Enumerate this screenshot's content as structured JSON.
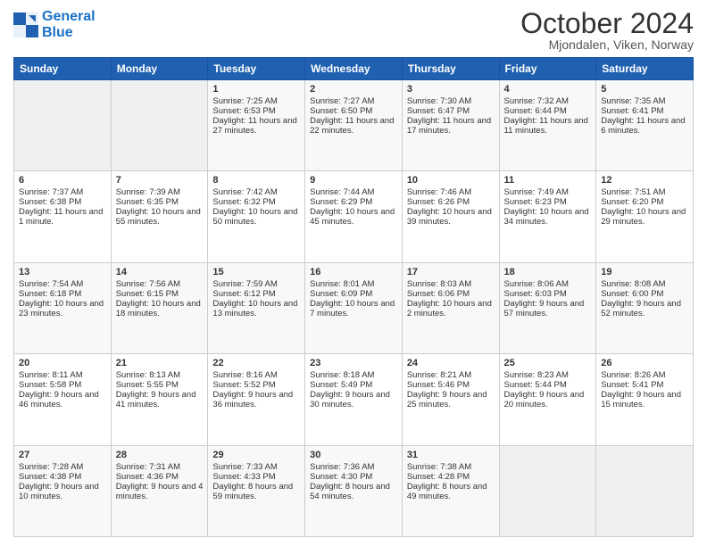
{
  "logo": {
    "line1": "General",
    "line2": "Blue"
  },
  "title": "October 2024",
  "location": "Mjondalen, Viken, Norway",
  "days_of_week": [
    "Sunday",
    "Monday",
    "Tuesday",
    "Wednesday",
    "Thursday",
    "Friday",
    "Saturday"
  ],
  "weeks": [
    [
      {
        "day": "",
        "content": ""
      },
      {
        "day": "",
        "content": ""
      },
      {
        "day": "1",
        "content": "Sunrise: 7:25 AM\nSunset: 6:53 PM\nDaylight: 11 hours and 27 minutes."
      },
      {
        "day": "2",
        "content": "Sunrise: 7:27 AM\nSunset: 6:50 PM\nDaylight: 11 hours and 22 minutes."
      },
      {
        "day": "3",
        "content": "Sunrise: 7:30 AM\nSunset: 6:47 PM\nDaylight: 11 hours and 17 minutes."
      },
      {
        "day": "4",
        "content": "Sunrise: 7:32 AM\nSunset: 6:44 PM\nDaylight: 11 hours and 11 minutes."
      },
      {
        "day": "5",
        "content": "Sunrise: 7:35 AM\nSunset: 6:41 PM\nDaylight: 11 hours and 6 minutes."
      }
    ],
    [
      {
        "day": "6",
        "content": "Sunrise: 7:37 AM\nSunset: 6:38 PM\nDaylight: 11 hours and 1 minute."
      },
      {
        "day": "7",
        "content": "Sunrise: 7:39 AM\nSunset: 6:35 PM\nDaylight: 10 hours and 55 minutes."
      },
      {
        "day": "8",
        "content": "Sunrise: 7:42 AM\nSunset: 6:32 PM\nDaylight: 10 hours and 50 minutes."
      },
      {
        "day": "9",
        "content": "Sunrise: 7:44 AM\nSunset: 6:29 PM\nDaylight: 10 hours and 45 minutes."
      },
      {
        "day": "10",
        "content": "Sunrise: 7:46 AM\nSunset: 6:26 PM\nDaylight: 10 hours and 39 minutes."
      },
      {
        "day": "11",
        "content": "Sunrise: 7:49 AM\nSunset: 6:23 PM\nDaylight: 10 hours and 34 minutes."
      },
      {
        "day": "12",
        "content": "Sunrise: 7:51 AM\nSunset: 6:20 PM\nDaylight: 10 hours and 29 minutes."
      }
    ],
    [
      {
        "day": "13",
        "content": "Sunrise: 7:54 AM\nSunset: 6:18 PM\nDaylight: 10 hours and 23 minutes."
      },
      {
        "day": "14",
        "content": "Sunrise: 7:56 AM\nSunset: 6:15 PM\nDaylight: 10 hours and 18 minutes."
      },
      {
        "day": "15",
        "content": "Sunrise: 7:59 AM\nSunset: 6:12 PM\nDaylight: 10 hours and 13 minutes."
      },
      {
        "day": "16",
        "content": "Sunrise: 8:01 AM\nSunset: 6:09 PM\nDaylight: 10 hours and 7 minutes."
      },
      {
        "day": "17",
        "content": "Sunrise: 8:03 AM\nSunset: 6:06 PM\nDaylight: 10 hours and 2 minutes."
      },
      {
        "day": "18",
        "content": "Sunrise: 8:06 AM\nSunset: 6:03 PM\nDaylight: 9 hours and 57 minutes."
      },
      {
        "day": "19",
        "content": "Sunrise: 8:08 AM\nSunset: 6:00 PM\nDaylight: 9 hours and 52 minutes."
      }
    ],
    [
      {
        "day": "20",
        "content": "Sunrise: 8:11 AM\nSunset: 5:58 PM\nDaylight: 9 hours and 46 minutes."
      },
      {
        "day": "21",
        "content": "Sunrise: 8:13 AM\nSunset: 5:55 PM\nDaylight: 9 hours and 41 minutes."
      },
      {
        "day": "22",
        "content": "Sunrise: 8:16 AM\nSunset: 5:52 PM\nDaylight: 9 hours and 36 minutes."
      },
      {
        "day": "23",
        "content": "Sunrise: 8:18 AM\nSunset: 5:49 PM\nDaylight: 9 hours and 30 minutes."
      },
      {
        "day": "24",
        "content": "Sunrise: 8:21 AM\nSunset: 5:46 PM\nDaylight: 9 hours and 25 minutes."
      },
      {
        "day": "25",
        "content": "Sunrise: 8:23 AM\nSunset: 5:44 PM\nDaylight: 9 hours and 20 minutes."
      },
      {
        "day": "26",
        "content": "Sunrise: 8:26 AM\nSunset: 5:41 PM\nDaylight: 9 hours and 15 minutes."
      }
    ],
    [
      {
        "day": "27",
        "content": "Sunrise: 7:28 AM\nSunset: 4:38 PM\nDaylight: 9 hours and 10 minutes."
      },
      {
        "day": "28",
        "content": "Sunrise: 7:31 AM\nSunset: 4:36 PM\nDaylight: 9 hours and 4 minutes."
      },
      {
        "day": "29",
        "content": "Sunrise: 7:33 AM\nSunset: 4:33 PM\nDaylight: 8 hours and 59 minutes."
      },
      {
        "day": "30",
        "content": "Sunrise: 7:36 AM\nSunset: 4:30 PM\nDaylight: 8 hours and 54 minutes."
      },
      {
        "day": "31",
        "content": "Sunrise: 7:38 AM\nSunset: 4:28 PM\nDaylight: 8 hours and 49 minutes."
      },
      {
        "day": "",
        "content": ""
      },
      {
        "day": "",
        "content": ""
      }
    ]
  ]
}
